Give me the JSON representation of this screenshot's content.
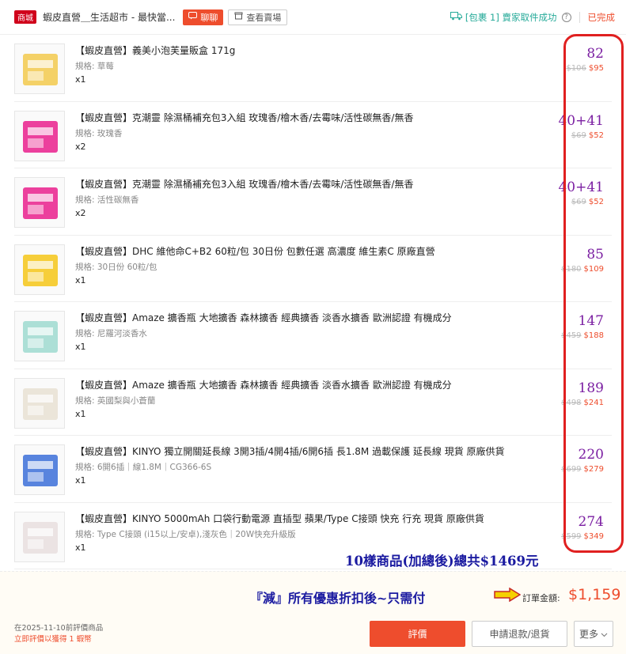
{
  "header": {
    "mall_badge": "商城",
    "shop_name": "蝦皮直營＿生活超市 - 最快當...",
    "chat_label": "聊聊",
    "view_shop_label": "查看賣場",
    "delivery_text": "[包裹 1] 賣家取件成功",
    "status_text": "已完成"
  },
  "items": [
    {
      "title": "【蝦皮直營】義美小泡芙量販盒 171g",
      "spec": "規格: 草莓",
      "qty": "x1",
      "hand_price": "82",
      "original_price": "$106",
      "price": "$95",
      "thumb_color": "#f2c94c"
    },
    {
      "title": "【蝦皮直營】克潮靈 除濕桶補充包3入組 玫瑰香/檜木香/去霉味/活性碳無香/無香",
      "spec": "規格: 玫瑰香",
      "qty": "x2",
      "hand_price": "40+41",
      "original_price": "$69",
      "price": "$52",
      "thumb_color": "#e91e8c"
    },
    {
      "title": "【蝦皮直營】克潮靈 除濕桶補充包3入組 玫瑰香/檜木香/去霉味/活性碳無香/無香",
      "spec": "規格: 活性碳無香",
      "qty": "x2",
      "hand_price": "40+41",
      "original_price": "$69",
      "price": "$52",
      "thumb_color": "#e91e8c"
    },
    {
      "title": "【蝦皮直營】DHC 維他命C+B2 60粒/包 30日份 包數任選 高濃度 維生素C 原廠直營",
      "spec": "規格: 30日份 60粒/包",
      "qty": "x1",
      "hand_price": "85",
      "original_price": "$180",
      "price": "$109",
      "thumb_color": "#f5c518"
    },
    {
      "title": "【蝦皮直營】Amaze 擴香瓶 大地擴香 森林擴香 經典擴香 淡香水擴香 歐洲認證 有機成分",
      "spec": "規格: 尼羅河淡香水",
      "qty": "x1",
      "hand_price": "147",
      "original_price": "$459",
      "price": "$188",
      "thumb_color": "#9ed9cf"
    },
    {
      "title": "【蝦皮直營】Amaze 擴香瓶 大地擴香 森林擴香 經典擴香 淡香水擴香 歐洲認證 有機成分",
      "spec": "規格: 英國梨與小蒼蘭",
      "qty": "x1",
      "hand_price": "189",
      "original_price": "$498",
      "price": "$241",
      "thumb_color": "#e8e0d2"
    },
    {
      "title": "【蝦皮直營】KINYO 獨立開關延長線 3開3插/4開4插/6開6插 長1.8M 過載保護 延長線 現貨 原廠供貨",
      "spec": "規格: 6開6插｜線1.8M｜CG366-6S",
      "qty": "x1",
      "hand_price": "220",
      "original_price": "$699",
      "price": "$279",
      "thumb_color": "#3b6fd8"
    },
    {
      "title": "【蝦皮直營】KINYO 5000mAh 口袋行動電源 直插型 蘋果/Type C接頭 快充 行充 現貨 原廠供貨",
      "spec": "規格: Type C接頭 (i15以上/安卓),淺灰色｜20W快充升級版",
      "qty": "x1",
      "hand_price": "274",
      "original_price": "$599",
      "price": "$349",
      "thumb_color": "#e8dede"
    }
  ],
  "annotation_total": "10樣商品(加總後)總共$1469元",
  "footer": {
    "annotation_discount": "『減』所有優惠折扣後~只需付",
    "order_total_label": "訂單金額:",
    "order_total": "$1,159",
    "rate_deadline": "在2025-11-10前評價商品",
    "rate_reward": "立即評價以獲得 1 蝦幣",
    "rate_button": "評價",
    "refund_button": "申請退款/退貨",
    "more_button": "更多"
  },
  "colors": {
    "accent": "#ee4d2d",
    "annotation_red": "#e02020",
    "handwriting_purple": "#7b1fa2",
    "annotation_blue": "#1a1aa0",
    "delivery_teal": "#26aa99"
  }
}
